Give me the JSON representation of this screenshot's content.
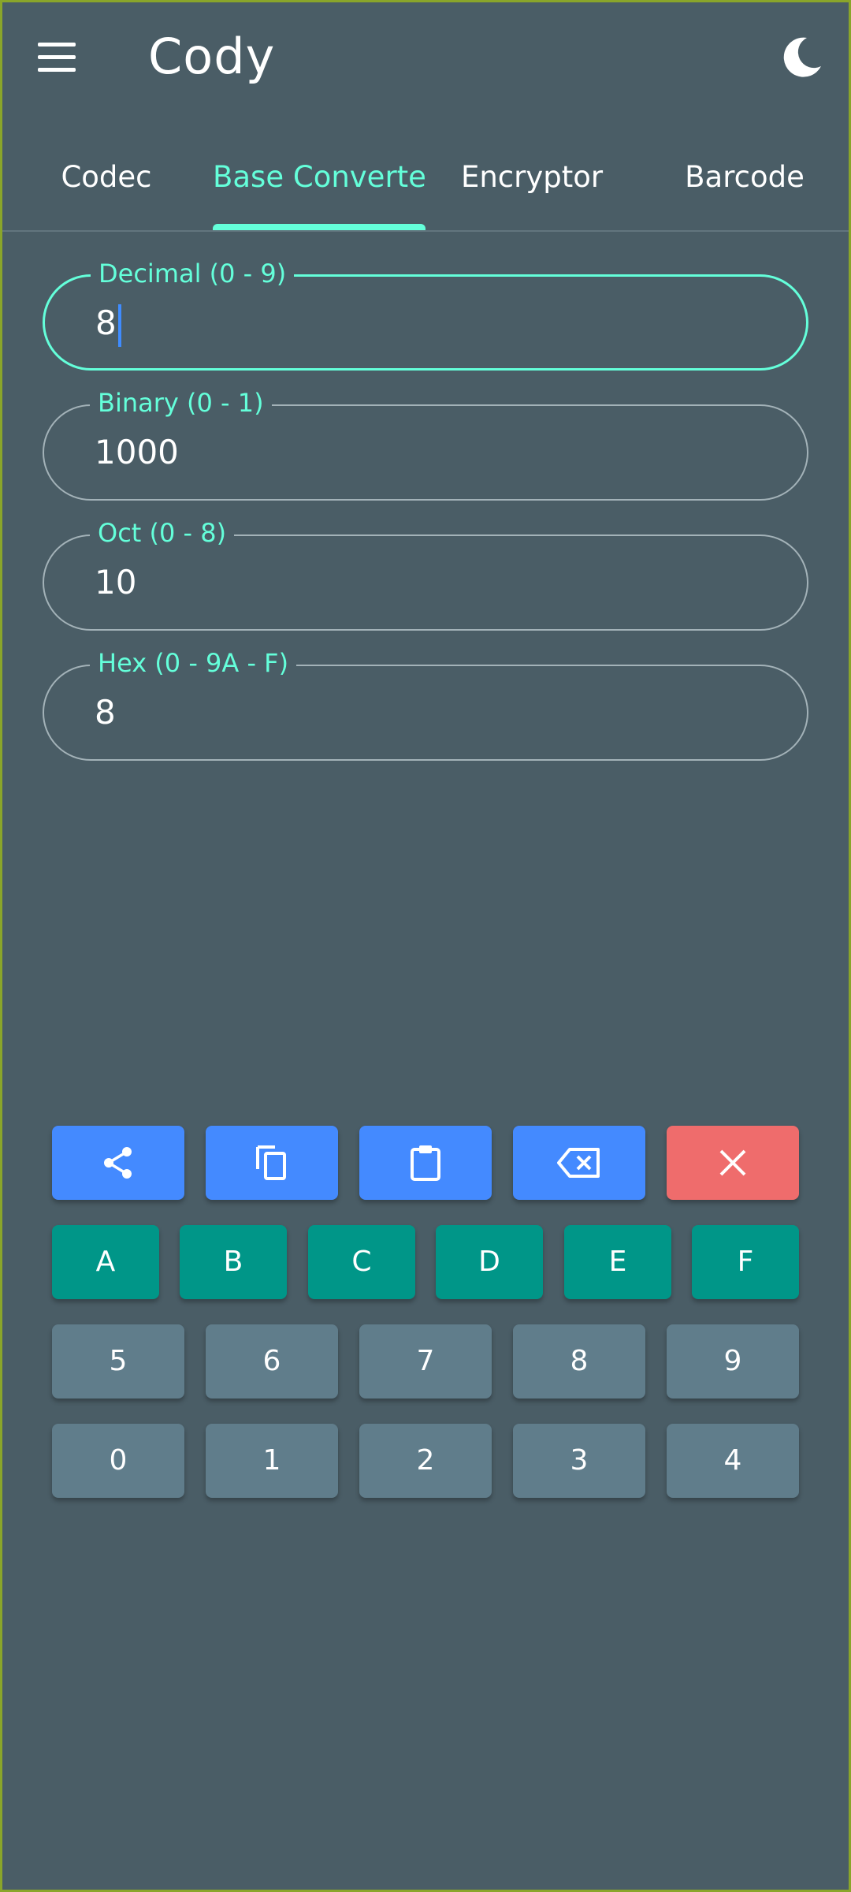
{
  "app": {
    "title": "Cody"
  },
  "icons": {
    "menu": "menu-icon",
    "theme": "moon-icon",
    "share": "share-icon",
    "copy": "copy-icon",
    "paste": "clipboard-icon",
    "backspace": "backspace-icon",
    "clear": "close-icon"
  },
  "tabs": [
    {
      "label": "Codec"
    },
    {
      "label": "Base Converter",
      "active": true
    },
    {
      "label": "Encryptor"
    },
    {
      "label": "Barcode"
    }
  ],
  "fields": {
    "decimal": {
      "label": "Decimal (0 - 9)",
      "value": "8"
    },
    "binary": {
      "label": "Binary (0 - 1)",
      "value": "1000"
    },
    "octal": {
      "label": "Oct (0 - 8)",
      "value": "10"
    },
    "hex": {
      "label": "Hex (0 - 9A - F)",
      "value": "8"
    }
  },
  "keypad": {
    "hex_row": [
      "A",
      "B",
      "C",
      "D",
      "E",
      "F"
    ],
    "row1": [
      "5",
      "6",
      "7",
      "8",
      "9"
    ],
    "row2": [
      "0",
      "1",
      "2",
      "3",
      "4"
    ]
  },
  "colors": {
    "background": "#4a5d66",
    "accent": "#64ffda",
    "action_blue": "#448aff",
    "clear_red": "#ef6c6c",
    "hex_teal": "#009688",
    "digit_grey": "#607d8b"
  }
}
